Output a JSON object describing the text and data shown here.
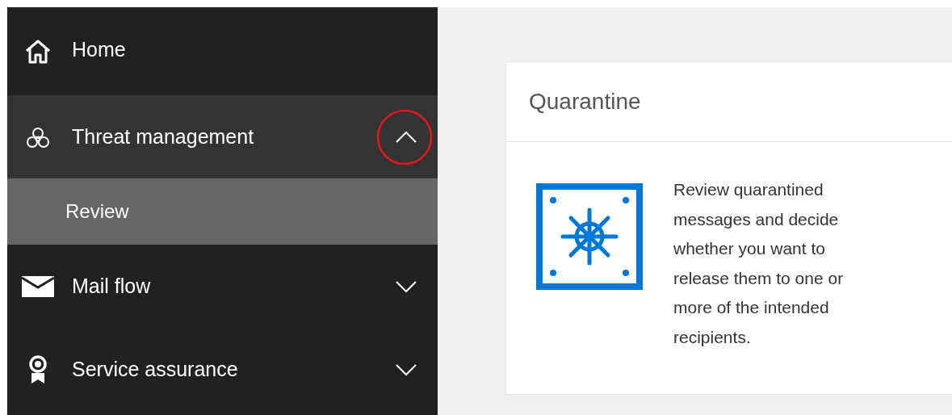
{
  "sidebar": {
    "items": [
      {
        "kind": "link",
        "label": "Home",
        "selected": false
      },
      {
        "kind": "group",
        "label": "Threat management",
        "selected": true,
        "expanded": true,
        "children": [
          {
            "label": "Review",
            "selected": true
          }
        ]
      },
      {
        "kind": "group",
        "label": "Mail flow",
        "selected": false,
        "expanded": false
      },
      {
        "kind": "group",
        "label": "Service assurance",
        "selected": false,
        "expanded": false
      }
    ]
  },
  "card": {
    "title": "Quarantine",
    "text": "Review quarantined messages and decide whether you want to release them to one or more of the intended recipients."
  },
  "annotation": {
    "kind": "circle",
    "color": "#e8141c"
  }
}
